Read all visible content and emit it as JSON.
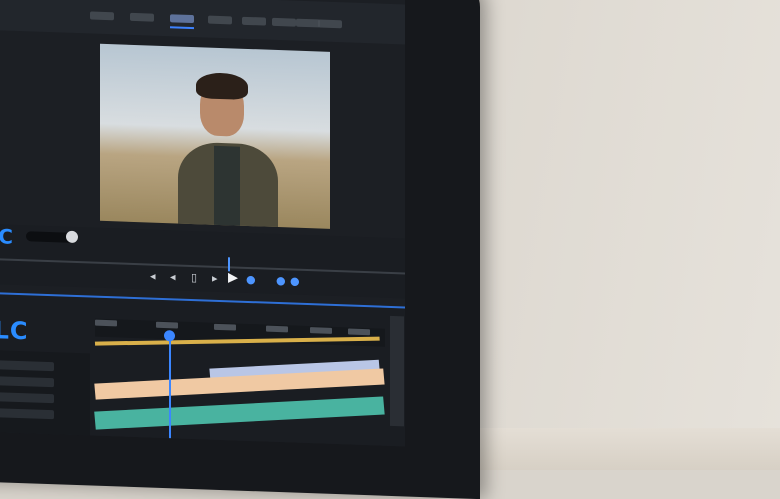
{
  "app": {
    "logo_top": "VLC",
    "logo_bottom": "VLC"
  },
  "colors": {
    "accent": "#3b86ff",
    "workarea": "#d9b04a",
    "video_clip": "#f0c9a3",
    "audio_clip": "#49b3a0"
  },
  "icons": {
    "rewind": "◂",
    "step_back": "◂",
    "stop": "▫",
    "step_fwd": "▸",
    "play": "▶",
    "marker": "●",
    "mark_in": "●",
    "mark_out": "●"
  },
  "transport": {
    "rewind_glyph": "◂",
    "prev_glyph": "◂",
    "stop_glyph": "▯",
    "next_glyph": "▸",
    "play_glyph": "▶",
    "marker_glyph": "●",
    "in_glyph": "●",
    "out_glyph": "●"
  }
}
